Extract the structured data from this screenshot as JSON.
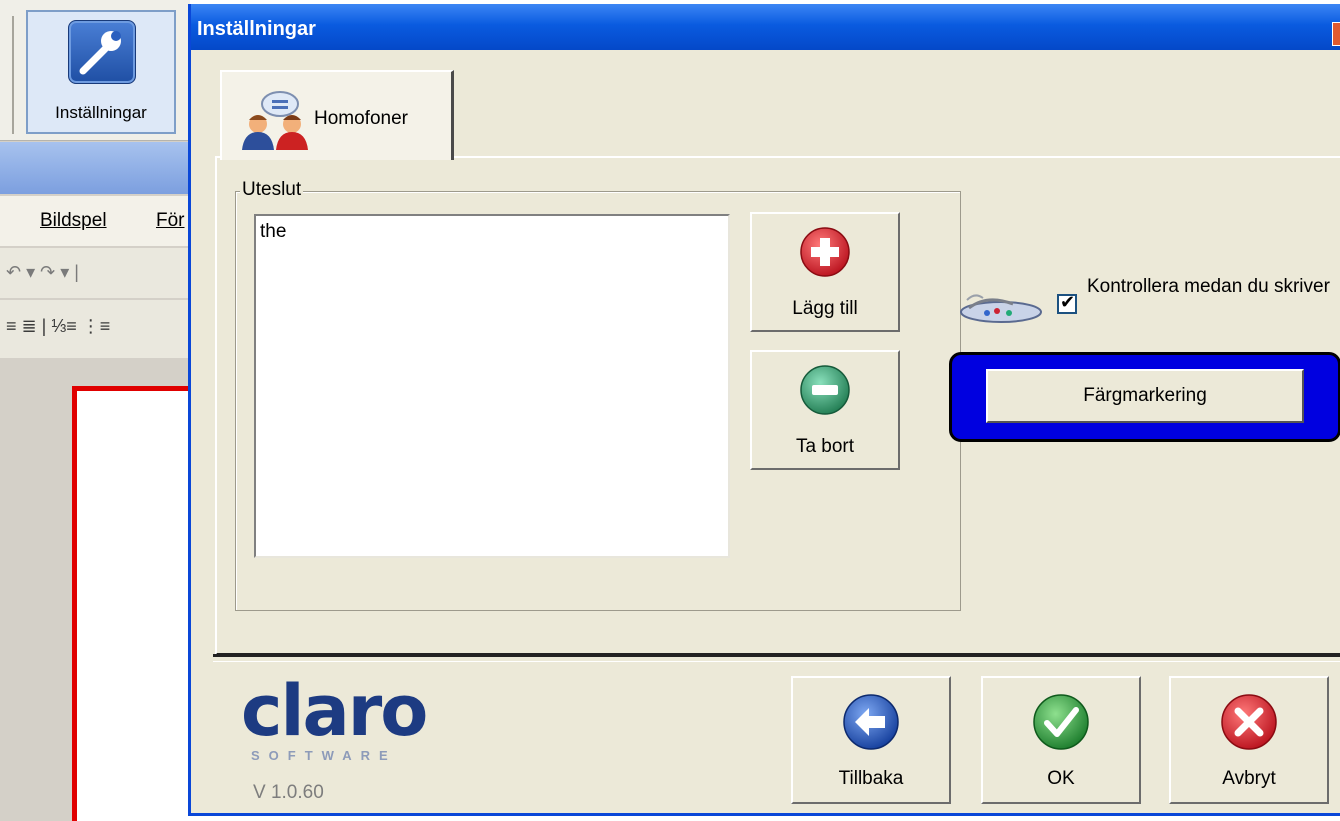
{
  "background_app": {
    "ribbon_button_label": "Inställningar",
    "menu_items": [
      "Bildspel",
      "För"
    ],
    "toolbar1_glyphs": "↶ ▾ ↷ ▾ |",
    "toolbar2_glyphs": "≡ ≣ | ⅓≡ ⋮≡"
  },
  "dialog": {
    "title": "Inställningar",
    "tab_label": "Homofoner",
    "group_label": "Uteslut",
    "excluded_words": [
      "the"
    ],
    "add_button": "Lägg till",
    "remove_button": "Ta bort",
    "check_while_typing": {
      "label": "Kontrollera medan du skriver",
      "checked": true
    },
    "color_button": "Färgmarkering",
    "footer": {
      "logo_main": "claro",
      "logo_sub": "SOFTWARE",
      "version": "V 1.0.60",
      "back_button": "Tillbaka",
      "ok_button": "OK",
      "cancel_button": "Avbryt"
    }
  },
  "colors": {
    "titlebar": "#0a5be0",
    "dialog_bg": "#ece9d8",
    "highlight_frame": "#0000e0",
    "add_icon": "#d9202a",
    "remove_icon": "#2e9a6a",
    "back_icon": "#1f55c0",
    "ok_icon": "#2ea043",
    "cancel_icon": "#d9202a"
  }
}
